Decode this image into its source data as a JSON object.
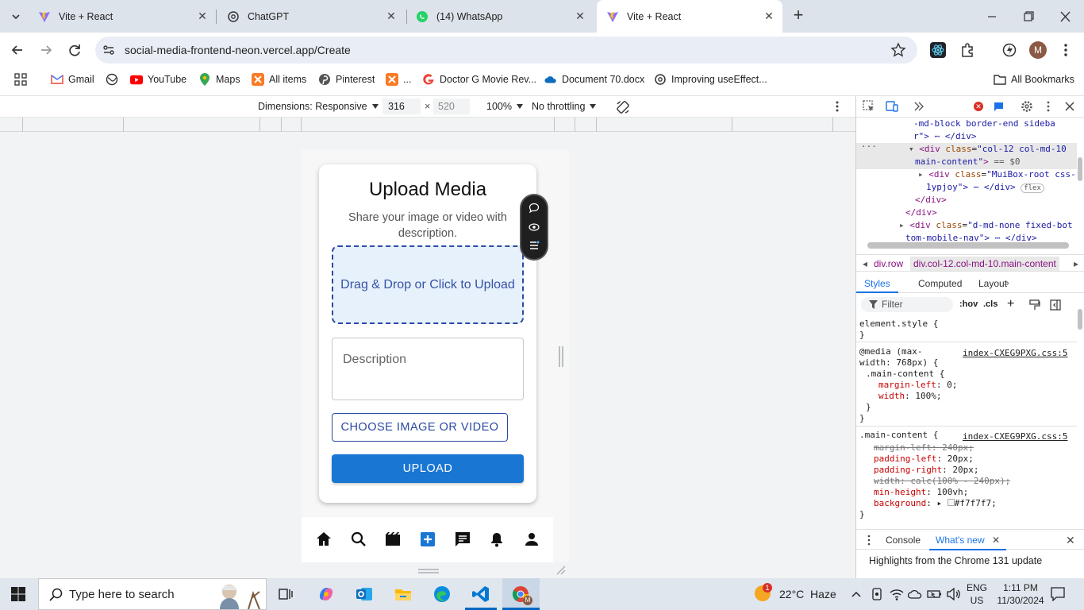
{
  "tabs": [
    {
      "title": "Vite + React",
      "active": false
    },
    {
      "title": "ChatGPT",
      "active": false
    },
    {
      "title": "(14) WhatsApp",
      "active": false
    },
    {
      "title": "Vite + React",
      "active": true
    }
  ],
  "address": {
    "url": "social-media-frontend-neon.vercel.app/Create"
  },
  "bookmarks": {
    "items": [
      "Gmail",
      "YouTube",
      "Maps",
      "All items",
      "Pinterest",
      "...",
      "Doctor G Movie Rev...",
      "Document 70.docx",
      "Improving useEffect..."
    ],
    "all_bookmarks": "All Bookmarks"
  },
  "device_toolbar": {
    "dimensions": "Dimensions: Responsive",
    "width": "316",
    "height": "520",
    "zoom": "100%",
    "throttling": "No throttling"
  },
  "page": {
    "title": "Upload Media",
    "subtitle": "Share your image or video with description.",
    "dropzone": "Drag & Drop or Click to Upload",
    "description_placeholder": "Description",
    "choose_button": "CHOOSE IMAGE OR VIDEO",
    "upload_button": "UPLOAD"
  },
  "devtools": {
    "elements": [
      "-md-block border-end sideba",
      "r\"> ⋯ </div>",
      "== $0",
      "1ypjoy\"> ⋯ </div>",
      "flex",
      "</div>",
      "</div>",
      "tom-mobile-nav\"> ⋯ </div>"
    ],
    "breadcrumbs": [
      "div.row",
      "div.col-12.col-md-10.main-content"
    ],
    "tabs": [
      "Styles",
      "Computed",
      "Layout"
    ],
    "filter_placeholder": "Filter",
    "hov": ":hov",
    "cls": ".cls",
    "file_ref": "index-CXEG9PXG.css:5",
    "drawer_tabs": [
      "Console",
      "What's new"
    ],
    "highlight": "Highlights from the Chrome 131 update"
  },
  "taskbar": {
    "search_placeholder": "Type here to search",
    "weather": "22°C  Haze",
    "lang": "ENG",
    "region": "US",
    "time": "1:11 PM",
    "date": "11/30/2024",
    "weather_badge": "1"
  },
  "colors": {
    "accent_blue": "#1976d2",
    "outline_blue": "#2a4aa0",
    "dropzone_bg": "#e7f1fb",
    "devtools_selected_tab": "#1a73e8"
  }
}
